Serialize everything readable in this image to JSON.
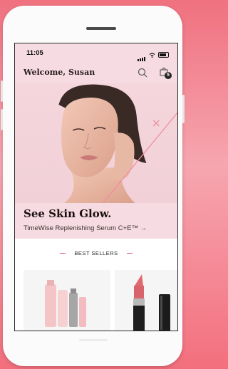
{
  "status_bar": {
    "time": "11:05"
  },
  "header": {
    "welcome": "Welcome, Susan",
    "bag_count": "5"
  },
  "promo": {
    "headline": "See Skin Glow.",
    "subtitle": "TimeWise Replenishing Serum C+E™ →"
  },
  "section": {
    "title": "BEST SELLERS"
  },
  "icons": [
    "search-icon",
    "shopping-bag-icon",
    "signal-icon",
    "wifi-icon",
    "battery-icon",
    "arrow-right-icon"
  ],
  "colors": {
    "accent": "#e35b6b",
    "header_bg": "#f6dce2",
    "page_bg": "#f0717f"
  }
}
